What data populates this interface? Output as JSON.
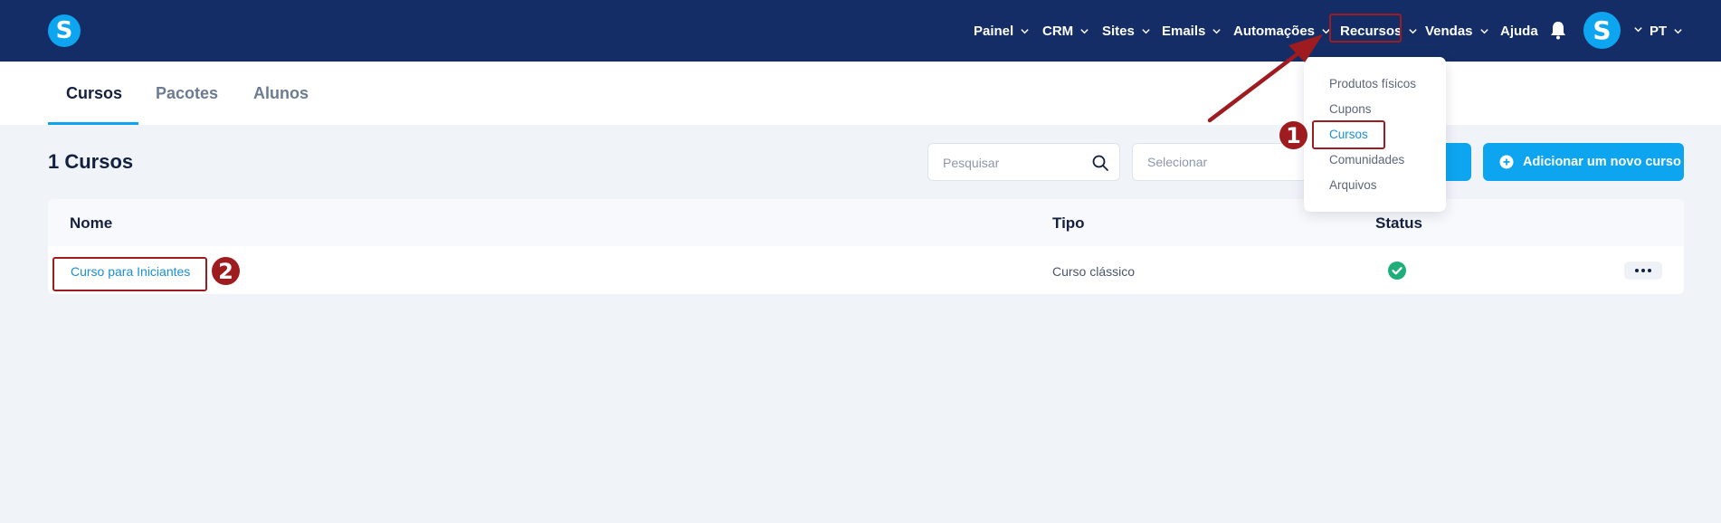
{
  "topnav": {
    "logo": "S",
    "items": [
      {
        "label": "Painel",
        "has_chevron": true
      },
      {
        "label": "CRM",
        "has_chevron": true
      },
      {
        "label": "Sites",
        "has_chevron": true
      },
      {
        "label": "Emails",
        "has_chevron": true
      },
      {
        "label": "Automações",
        "has_chevron": true
      },
      {
        "label": "Recursos",
        "has_chevron": true
      },
      {
        "label": "Vendas",
        "has_chevron": true
      },
      {
        "label": "Ajuda",
        "has_chevron": false
      }
    ],
    "avatar": "S",
    "language": "PT",
    "bell_icon": "bell-icon"
  },
  "tabs": [
    {
      "label": "Cursos",
      "active": true
    },
    {
      "label": "Pacotes",
      "active": false
    },
    {
      "label": "Alunos",
      "active": false
    }
  ],
  "page": {
    "title": "1 Cursos",
    "search_placeholder": "Pesquisar",
    "select_placeholder": "Selecionar",
    "add_button": "Adicionar um novo curso"
  },
  "table": {
    "headers": {
      "name": "Nome",
      "type": "Tipo",
      "status": "Status"
    },
    "rows": [
      {
        "name": "Curso para Iniciantes",
        "type": "Curso clássico",
        "status": "active"
      }
    ]
  },
  "dropdown": {
    "items": [
      "Produtos físicos",
      "Cupons",
      "Cursos",
      "Comunidades",
      "Arquivos"
    ],
    "active": "Cursos"
  },
  "annotations": {
    "step1": "1",
    "step2": "2"
  },
  "colors": {
    "nav_bg": "#142d66",
    "accent": "#0ea5f0",
    "link": "#1a8fd6",
    "annotation": "#9e1b1f",
    "status_ok": "#1fae7a"
  }
}
